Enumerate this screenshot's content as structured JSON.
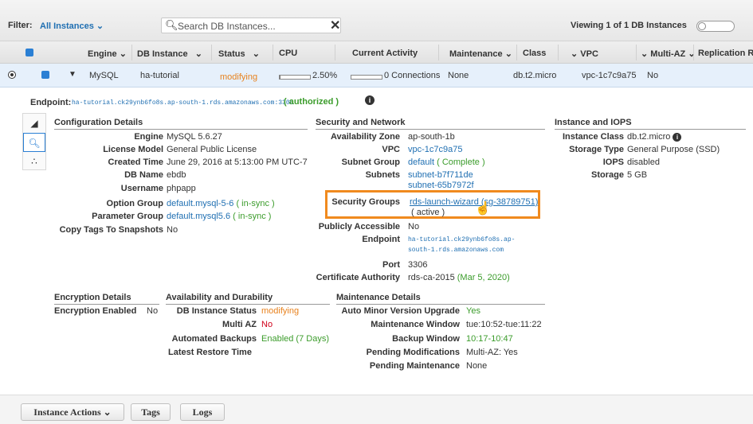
{
  "filter": {
    "label": "Filter:",
    "value": "All Instances",
    "search_placeholder": "Search DB Instances...",
    "clear_glyph": "✕",
    "viewing": "Viewing 1 of 1 DB Instances"
  },
  "columns": [
    "Engine",
    "DB Instance",
    "Status",
    "CPU",
    "Current Activity",
    "Maintenance",
    "Class",
    "VPC",
    "Multi-AZ",
    "Replication R"
  ],
  "row": {
    "engine": "MySQL",
    "db_instance": "ha-tutorial",
    "status": "modifying",
    "cpu": "2.50%",
    "cpu_fraction": 0.025,
    "activity": "0 Connections",
    "maintenance": "None",
    "class": "db.t2.micro",
    "vpc": "vpc-1c7c9a75",
    "multi_az": "No"
  },
  "endpoint": {
    "label": "Endpoint:",
    "value": "ha-tutorial.ck29ynb6fo8s.ap-south-1.rds.amazonaws.com:3306",
    "status": "( authorized )"
  },
  "config": {
    "title": "Configuration Details",
    "engine_label": "Engine",
    "engine": "MySQL 5.6.27",
    "license_label": "License Model",
    "license": "General Public License",
    "created_label": "Created Time",
    "created": "June 29, 2016 at 5:13:00 PM UTC-7",
    "dbname_label": "DB Name",
    "dbname": "ebdb",
    "username_label": "Username",
    "username": "phpapp",
    "optgroup_label": "Option Group",
    "optgroup": "default.mysql-5-6",
    "optgroup_status": "( in-sync )",
    "paramgroup_label": "Parameter Group",
    "paramgroup": "default.mysql5.6",
    "paramgroup_status": "( in-sync )",
    "copytags_label": "Copy Tags To Snapshots",
    "copytags": "No"
  },
  "security": {
    "title": "Security and Network",
    "az_label": "Availability Zone",
    "az": "ap-south-1b",
    "vpc_label": "VPC",
    "vpc": "vpc-1c7c9a75",
    "subnetgroup_label": "Subnet Group",
    "subnetgroup": "default",
    "subnetgroup_status": "( Complete )",
    "subnets_label": "Subnets",
    "subnet1": "subnet-b7f711de",
    "subnet2": "subnet-65b7972f",
    "sg_label": "Security Groups",
    "sg": "rds-launch-wizard (sg-38789751)",
    "sg_status": "( active )",
    "public_label": "Publicly Accessible",
    "public": "No",
    "endpoint_label": "Endpoint",
    "endpoint1": "ha-tutorial.ck29ynb6fo8s.ap-",
    "endpoint2": "south-1.rds.amazonaws.com",
    "port_label": "Port",
    "port": "3306",
    "ca_label": "Certificate Authority",
    "ca": "rds-ca-2015",
    "ca_date": "(Mar 5, 2020)"
  },
  "iops": {
    "title": "Instance and IOPS",
    "class_label": "Instance Class",
    "class": "db.t2.micro",
    "storage_type_label": "Storage Type",
    "storage_type": "General Purpose (SSD)",
    "iops_label": "IOPS",
    "iops": "disabled",
    "storage_label": "Storage",
    "storage": "5 GB"
  },
  "encryption": {
    "title": "Encryption Details",
    "enabled_label": "Encryption Enabled",
    "enabled": "No"
  },
  "availability": {
    "title": "Availability and Durability",
    "status_label": "DB Instance Status",
    "status": "modifying",
    "multiaz_label": "Multi AZ",
    "multiaz": "No",
    "backups_label": "Automated Backups",
    "backups": "Enabled (7 Days)",
    "restore_label": "Latest Restore Time"
  },
  "maintenance": {
    "title": "Maintenance Details",
    "auto_label": "Auto Minor Version Upgrade",
    "auto": "Yes",
    "window_label": "Maintenance Window",
    "window": "tue:10:52-tue:11:22",
    "backup_label": "Backup Window",
    "backup": "10:17-10:47",
    "pending_mod_label": "Pending Modifications",
    "pending_mod": "Multi-AZ: Yes",
    "pending_maint_label": "Pending Maintenance",
    "pending_maint": "None"
  },
  "buttons": {
    "instance_actions": "Instance Actions",
    "tags": "Tags",
    "logs": "Logs"
  },
  "colors": {
    "link": "#1f6fb2",
    "ok": "#3b9c2b",
    "warning": "#e8821e",
    "highlight": "#f08a1e",
    "row_selected": "#e6f0fb"
  }
}
